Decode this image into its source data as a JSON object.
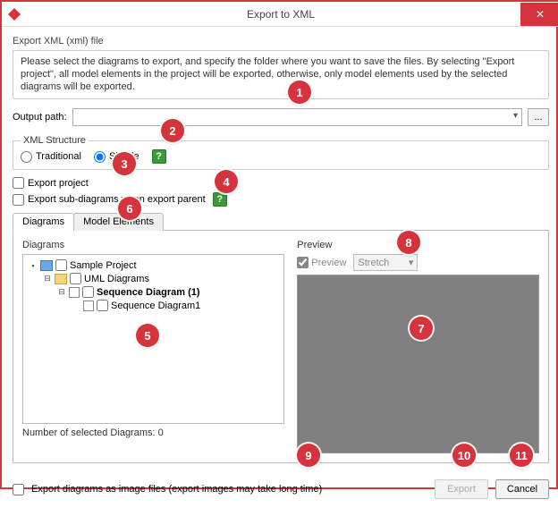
{
  "window": {
    "title": "Export to XML",
    "close_glyph": "✕"
  },
  "subhead": "Export XML (xml) file",
  "intro": "Please select the diagrams to export, and specify the folder where you want to save the files. By selecting \"Export project\", all model elements in the project will be exported, otherwise, only model elements used by the selected diagrams will be exported.",
  "output": {
    "label": "Output path:",
    "value": "",
    "browse_label": "..."
  },
  "xml_structure": {
    "legend": "XML Structure",
    "traditional": "Traditional",
    "simple": "Simple",
    "selected": "simple",
    "help_glyph": "?"
  },
  "options": {
    "export_project": "Export project",
    "export_sub": "Export sub-diagrams when export parent"
  },
  "tabs": {
    "diagrams": "Diagrams",
    "model_elements": "Model Elements"
  },
  "diagrams_panel": {
    "title": "Diagrams",
    "tree": {
      "root": "Sample Project",
      "folder": "UML Diagrams",
      "seq1": "Sequence Diagram (1)",
      "seq2": "Sequence Diagram1"
    },
    "count": "Number of selected Diagrams: 0"
  },
  "preview_panel": {
    "title": "Preview",
    "checkbox": "Preview",
    "stretch": "Stretch"
  },
  "footer": {
    "export_images": "Export diagrams as image files (export images may take long time)",
    "export_btn": "Export",
    "cancel_btn": "Cancel"
  },
  "callouts": [
    "1",
    "2",
    "3",
    "4",
    "5",
    "6",
    "7",
    "8",
    "9",
    "10",
    "11"
  ]
}
